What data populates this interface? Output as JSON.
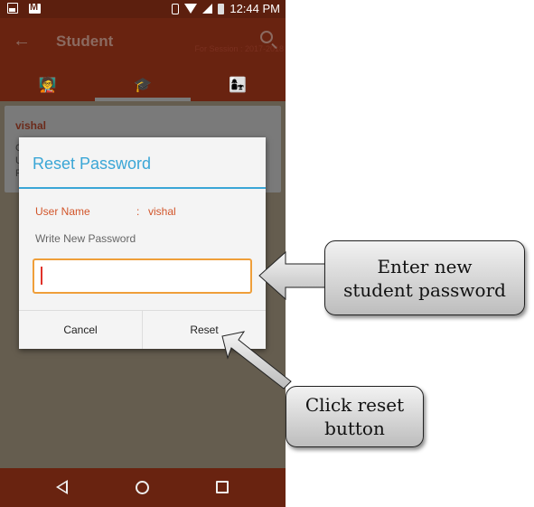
{
  "status_bar": {
    "time": "12:44 PM",
    "left_icons": [
      "image-icon",
      "gmail-icon"
    ],
    "right_icons": [
      "vibrate-icon",
      "wifi-icon",
      "signal-icon",
      "battery-icon"
    ]
  },
  "app_bar": {
    "title": "Student",
    "back_icon": "←",
    "session": "For Session : 2017-2018",
    "search_icon": "search-icon"
  },
  "tabs": [
    {
      "icon": "teacher-icon",
      "glyph": "🧑‍🏫",
      "active": false
    },
    {
      "icon": "graduate-student-icon",
      "glyph": "🎓",
      "active": true
    },
    {
      "icon": "parent-child-icon",
      "glyph": "👩‍👧",
      "active": false
    }
  ],
  "card": {
    "name": "vishal",
    "lines": [
      "C",
      "U",
      "P"
    ]
  },
  "dialog": {
    "title": "Reset Password",
    "username_label": "User Name",
    "colon": ":",
    "username_value": "vishal",
    "password_label": "Write New Password",
    "password_value": "",
    "cancel_label": "Cancel",
    "reset_label": "Reset"
  },
  "nav_bar": {
    "icons": [
      "back-icon",
      "home-icon",
      "recents-icon"
    ]
  },
  "annotations": [
    {
      "text": "Enter new student password",
      "line1": "Enter new",
      "line2": "student password"
    },
    {
      "text": "Click reset button",
      "line1": "Click reset",
      "line2": "button"
    }
  ],
  "colors": {
    "app_bar": "#692310",
    "status_bar": "#5c1f0e",
    "dialog_accent": "#3aa6d6",
    "label_orange": "#d2552a",
    "input_border": "#ef9f3a"
  }
}
